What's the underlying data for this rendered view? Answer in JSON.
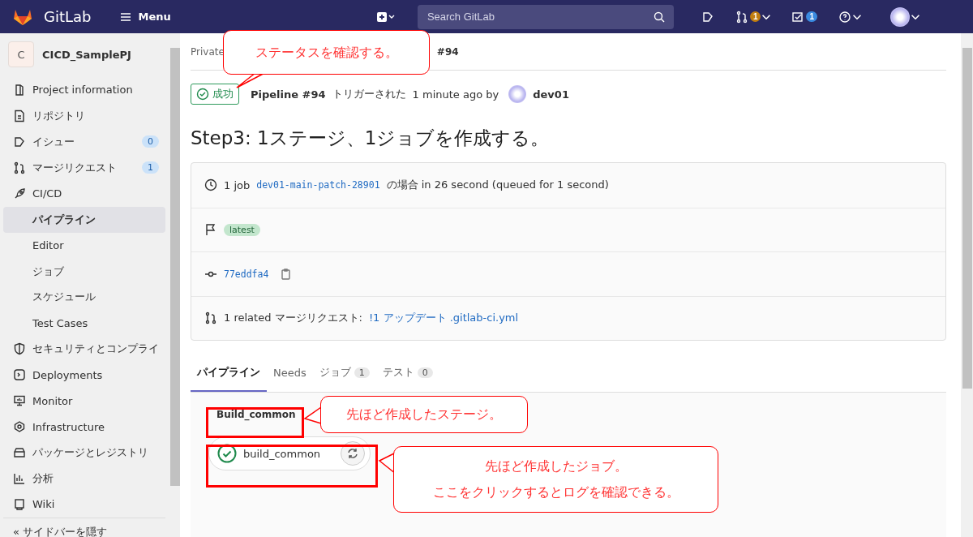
{
  "header": {
    "brand": "GitLab",
    "menu": "Menu",
    "search": {
      "placeholder": "Search GitLab"
    },
    "merge_requests_count": "1",
    "todos_count": "1"
  },
  "sidebar": {
    "project": {
      "initial": "C",
      "name": "CICD_SamplePJ"
    },
    "items": [
      {
        "label": "Project information",
        "selected": false
      },
      {
        "label": "リポジトリ",
        "selected": false
      },
      {
        "label": "イシュー",
        "count": "0",
        "selected": false
      },
      {
        "label": "マージリクエスト",
        "count": "1",
        "selected": false
      },
      {
        "label": "CI/CD",
        "selected": false,
        "children": [
          {
            "label": "パイプライン",
            "selected": true
          },
          {
            "label": "Editor",
            "selected": false
          },
          {
            "label": "ジョブ",
            "selected": false
          },
          {
            "label": "スケジュール",
            "selected": false
          },
          {
            "label": "Test Cases",
            "selected": false
          }
        ]
      },
      {
        "label": "セキュリティとコンプライ",
        "selected": false
      },
      {
        "label": "Deployments",
        "selected": false
      },
      {
        "label": "Monitor",
        "selected": false
      },
      {
        "label": "Infrastructure",
        "selected": false
      },
      {
        "label": "パッケージとレジストリ",
        "selected": false
      },
      {
        "label": "分析",
        "selected": false
      },
      {
        "label": "Wiki",
        "selected": false
      }
    ],
    "collapse": "« サイドバーを隠す"
  },
  "breadcrumb": [
    "Private",
    "#94"
  ],
  "pipeline": {
    "status": "成功",
    "title_prefix": "Pipeline #94",
    "triggered": "トリガーされた",
    "time": "1 minute ago by",
    "user": "dev01"
  },
  "title": "Step3: 1ステージ、1ジョブを作成する。",
  "info": {
    "jobs_prefix": "1 job",
    "branch": "dev01-main-patch-28901",
    "jobs_suffix": "の場合 in 26 second (queued for 1 second)",
    "tag": "latest",
    "commit": "77eddfa4",
    "related_prefix": "1 related マージリクエスト:",
    "related_link": "!1 アップデート .gitlab-ci.yml"
  },
  "tabs": [
    {
      "label": "パイプライン",
      "selected": true
    },
    {
      "label": "Needs",
      "selected": false
    },
    {
      "label": "ジョブ",
      "count": "1",
      "selected": false
    },
    {
      "label": "テスト",
      "count": "0",
      "selected": false
    }
  ],
  "stage": {
    "name": "Build_common",
    "jobs": [
      {
        "name": "build_common"
      }
    ]
  },
  "callouts": [
    [
      "ステータスを確認する。"
    ],
    [
      "先ほど作成したステージ。"
    ],
    [
      "先ほど作成したジョブ。",
      "ここをクリックするとログを確認できる。"
    ]
  ]
}
